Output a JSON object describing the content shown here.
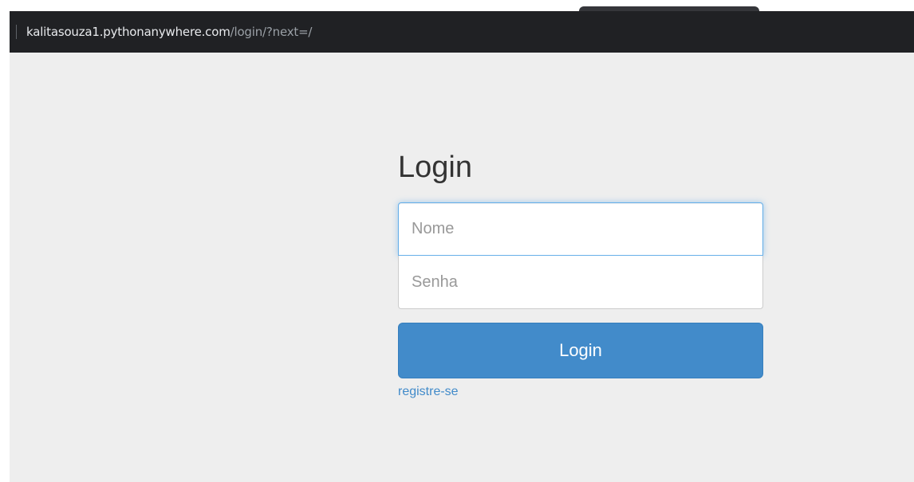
{
  "browser": {
    "url_host": "kalitasouza1.pythonanywhere.com",
    "url_path": "/login/?next=/"
  },
  "login_form": {
    "title": "Login",
    "username_placeholder": "Nome",
    "password_placeholder": "Senha",
    "submit_label": "Login",
    "register_link": "registre-se"
  },
  "colors": {
    "primary": "#428bca",
    "page_background": "#eeeeee",
    "address_bar": "#202124"
  }
}
